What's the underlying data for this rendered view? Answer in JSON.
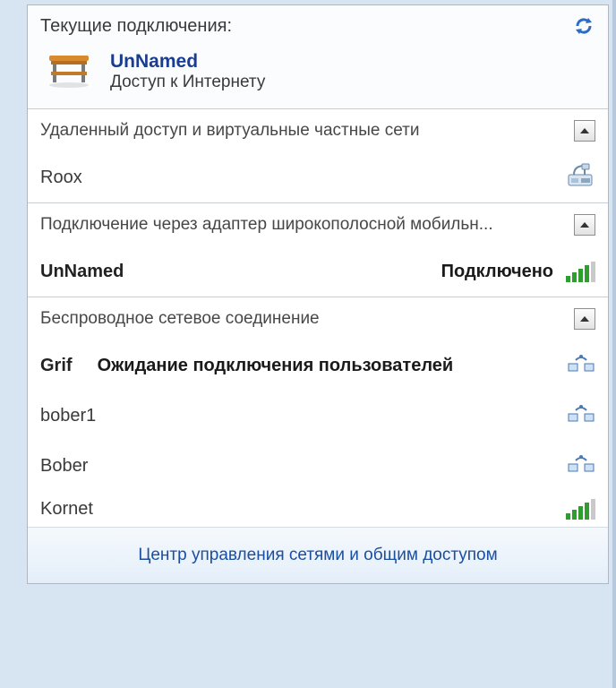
{
  "current": {
    "title": "Текущие подключения:",
    "name": "UnNamed",
    "status": "Доступ к Интернету"
  },
  "section_dialup": {
    "title": "Удаленный доступ и виртуальные частные сети",
    "items": [
      {
        "name": "Roox"
      }
    ]
  },
  "section_broadband": {
    "title": "Подключение через адаптер широкополосной мобильн...",
    "items": [
      {
        "name": "UnNamed",
        "status": "Подключено",
        "signal": 4
      }
    ]
  },
  "section_wireless": {
    "title": "Беспроводное сетевое соединение",
    "items": [
      {
        "name": "Grif",
        "status": "Ожидание подключения пользователей",
        "type": "adhoc"
      },
      {
        "name": "bober1",
        "type": "adhoc"
      },
      {
        "name": "Bober",
        "type": "adhoc"
      },
      {
        "name": "Kornet",
        "signal": 4
      }
    ]
  },
  "footer_link": "Центр управления сетями и общим доступом"
}
